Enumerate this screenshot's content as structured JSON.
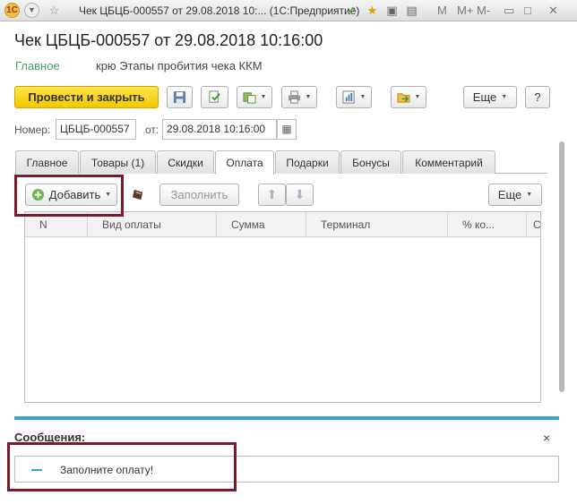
{
  "titlebar": {
    "title": "Чек ЦБЦБ-000557 от 29.08.2018 10:... (1С:Предприятие)",
    "controls": [
      "M",
      "M+",
      "M-"
    ]
  },
  "doc": {
    "title": "Чек ЦБЦБ-000557 от 29.08.2018 10:16:00",
    "nav_main": "Главное",
    "nav_link": "крю Этапы пробития чека ККМ"
  },
  "toolbar": {
    "post_close": "Провести и закрыть",
    "more": "Еще",
    "help": "?"
  },
  "header_fields": {
    "number_label": "Номер:",
    "number_value": "ЦБЦБ-000557",
    "date_label": "от:",
    "date_value": "29.08.2018 10:16:00"
  },
  "tabs": [
    "Главное",
    "Товары (1)",
    "Скидки",
    "Оплата",
    "Подарки",
    "Бонусы",
    "Комментарий"
  ],
  "active_tab": "Оплата",
  "table_toolbar": {
    "add": "Добавить",
    "fill": "Заполнить",
    "more": "Еще"
  },
  "table": {
    "columns": [
      "N",
      "Вид оплаты",
      "Сумма",
      "Терминал",
      "% ко...",
      "С"
    ]
  },
  "messages": {
    "title": "Сообщения:",
    "close": "×",
    "items": [
      "Заполните оплату!"
    ]
  },
  "colors": {
    "accent_blue": "#3aa0d8",
    "highlight_red": "#7a1a2a",
    "primary_yellow": "#f3c800",
    "nav_green": "#4aa06a"
  }
}
